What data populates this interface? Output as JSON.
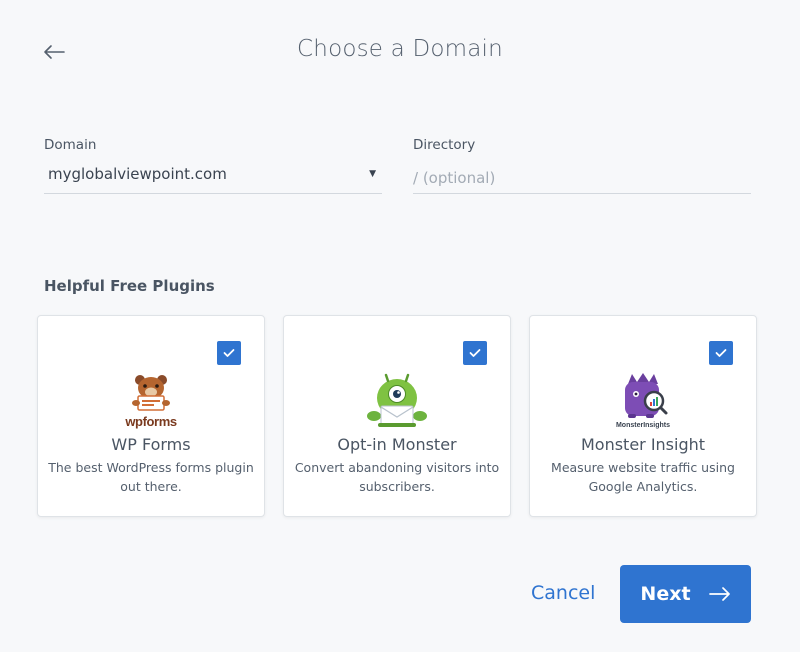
{
  "header": {
    "title": "Choose a Domain",
    "back_icon": "arrow-left-icon"
  },
  "form": {
    "domain": {
      "label": "Domain",
      "value": "myglobalviewpoint.com"
    },
    "directory": {
      "label": "Directory",
      "placeholder": "/ (optional)",
      "value": ""
    }
  },
  "plugins": {
    "heading": "Helpful Free Plugins",
    "items": [
      {
        "name": "WP Forms",
        "description": "The best WordPress forms plugin out there.",
        "logo_text": "wpforms",
        "checked": true,
        "logo_icon": "wpforms-bear-logo-icon"
      },
      {
        "name": "Opt-in Monster",
        "description": "Convert abandoning visitors into subscribers.",
        "logo_text": "",
        "checked": true,
        "logo_icon": "optinmonster-logo-icon"
      },
      {
        "name": "Monster Insight",
        "description": "Measure website traffic using Google Analytics.",
        "logo_text": "MonsterInsights",
        "checked": true,
        "logo_icon": "monsterinsights-logo-icon"
      }
    ]
  },
  "actions": {
    "cancel_label": "Cancel",
    "next_label": "Next"
  },
  "colors": {
    "accent": "#2f74d0",
    "background": "#f7f8fa",
    "card": "#ffffff"
  }
}
